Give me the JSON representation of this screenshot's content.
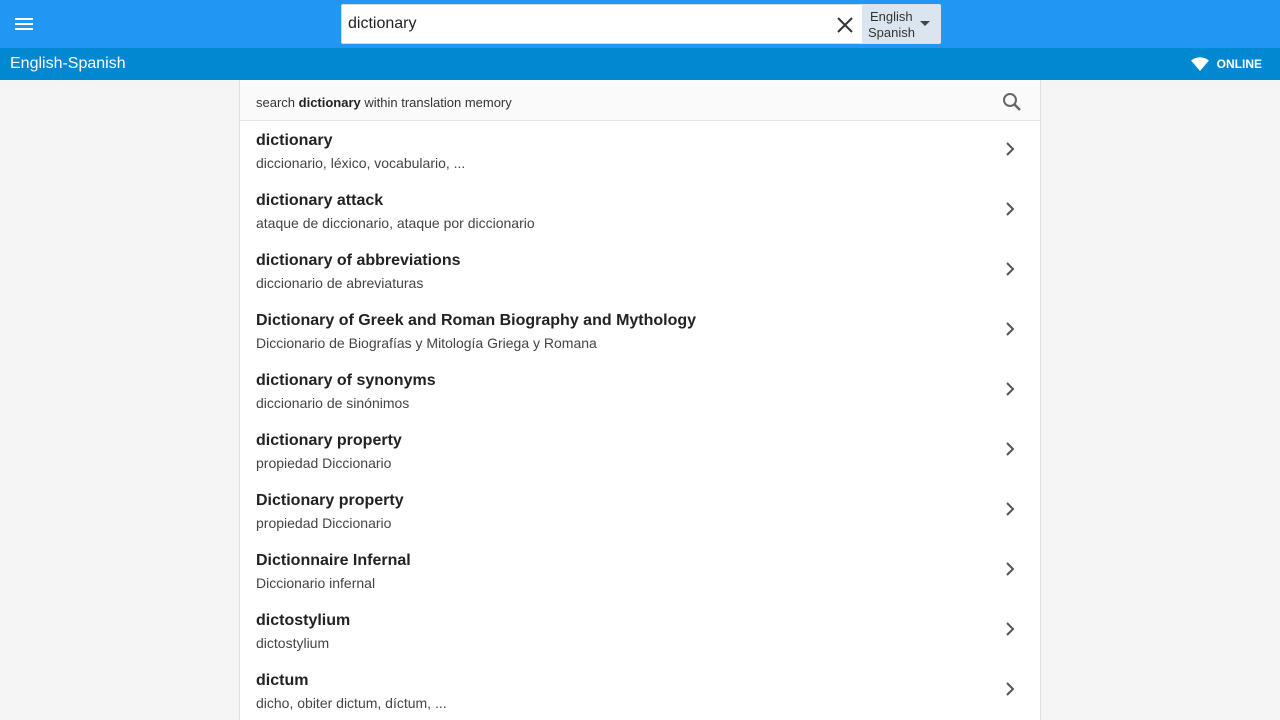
{
  "header": {
    "search_value": "dictionary",
    "lang_source": "English",
    "lang_target": "Spanish"
  },
  "subheader": {
    "title": "English-Spanish",
    "status": "ONLINE"
  },
  "tm_search": {
    "prefix": "search ",
    "term": "dictionary",
    "suffix": " within translation memory"
  },
  "results": [
    {
      "term": "dictionary",
      "translation": "diccionario, léxico, vocabulario, ..."
    },
    {
      "term": "dictionary attack",
      "translation": "ataque de diccionario, ataque por diccionario"
    },
    {
      "term": "dictionary of abbreviations",
      "translation": "diccionario de abreviaturas"
    },
    {
      "term": "Dictionary of Greek and Roman Biography and Mythology",
      "translation": "Diccionario de Biografías y Mitología Griega y Romana"
    },
    {
      "term": "dictionary of synonyms",
      "translation": "diccionario de sinónimos"
    },
    {
      "term": "dictionary property",
      "translation": "propiedad Diccionario"
    },
    {
      "term": "Dictionary property",
      "translation": "propiedad Diccionario"
    },
    {
      "term": "Dictionnaire Infernal",
      "translation": "Diccionario infernal"
    },
    {
      "term": "dictostylium",
      "translation": "dictostylium"
    },
    {
      "term": "dictum",
      "translation": "dicho, obiter dictum, díctum, ..."
    }
  ],
  "colors": {
    "topbar": "#2196f3",
    "subbar": "#0288d1"
  },
  "icons": {
    "menu": "menu-icon",
    "clear": "close-icon",
    "dropdown": "dropdown-arrow-icon",
    "wifi": "wifi-icon",
    "search": "search-icon",
    "chevron": "chevron-right-icon"
  }
}
